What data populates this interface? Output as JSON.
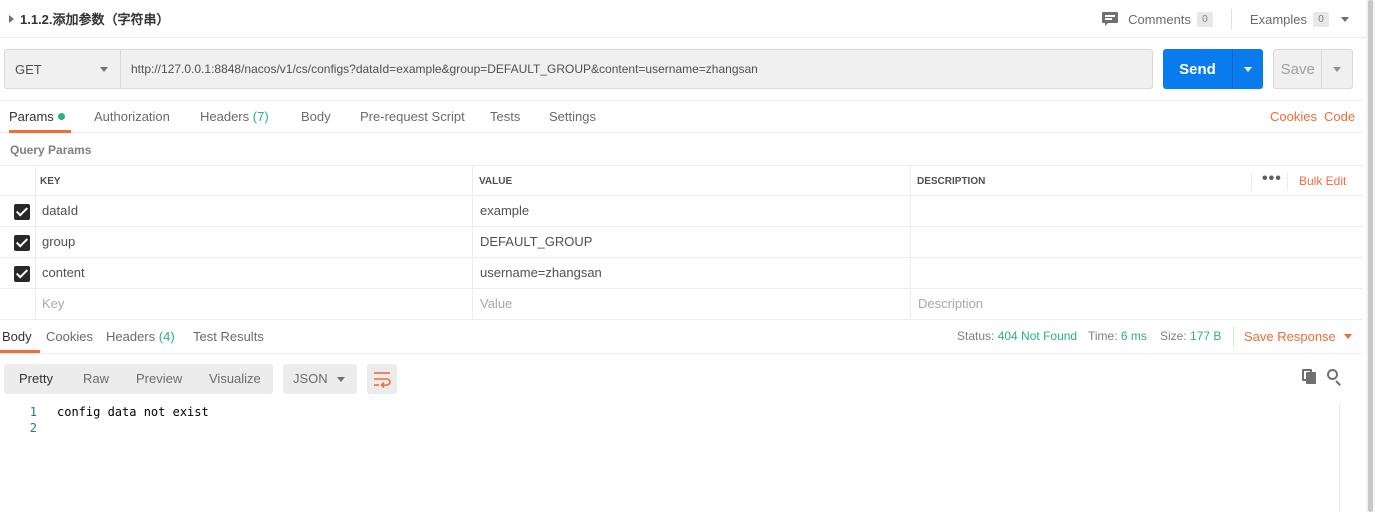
{
  "request": {
    "title": "1.1.2.添加参数（字符串）",
    "comments_label": "Comments",
    "comments_count": "0",
    "examples_label": "Examples",
    "examples_count": "0",
    "method": "GET",
    "url": "http://127.0.0.1:8848/nacos/v1/cs/configs?dataId=example&group=DEFAULT_GROUP&content=username=zhangsan",
    "send_label": "Send",
    "save_label": "Save"
  },
  "request_tabs": {
    "params": "Params",
    "authorization": "Authorization",
    "headers": "Headers",
    "headers_count": "(7)",
    "body": "Body",
    "pre_request_script": "Pre-request Script",
    "tests": "Tests",
    "settings": "Settings",
    "cookies": "Cookies",
    "code": "Code"
  },
  "query_params": {
    "section_label": "Query Params",
    "columns": {
      "key": "KEY",
      "value": "VALUE",
      "description": "DESCRIPTION"
    },
    "more_label": "•••",
    "bulk_edit_label": "Bulk Edit",
    "rows": [
      {
        "key": "dataId",
        "value": "example",
        "description": "",
        "checked": true
      },
      {
        "key": "group",
        "value": "DEFAULT_GROUP",
        "description": "",
        "checked": true
      },
      {
        "key": "content",
        "value": "username=zhangsan",
        "description": "",
        "checked": true
      }
    ],
    "placeholders": {
      "key": "Key",
      "value": "Value",
      "description": "Description"
    }
  },
  "response_tabs": {
    "body": "Body",
    "cookies": "Cookies",
    "headers": "Headers",
    "headers_count": "(4)",
    "test_results": "Test Results"
  },
  "response_meta": {
    "status_label": "Status:",
    "status_value": "404 Not Found",
    "time_label": "Time:",
    "time_value": "6 ms",
    "size_label": "Size:",
    "size_value": "177 B",
    "save_response_label": "Save Response"
  },
  "response_toolbar": {
    "pretty": "Pretty",
    "raw": "Raw",
    "preview": "Preview",
    "visualize": "Visualize",
    "format": "JSON"
  },
  "response_body": {
    "lines": [
      {
        "num": "1",
        "text": "config data not exist"
      },
      {
        "num": "2",
        "text": ""
      }
    ]
  },
  "colors": {
    "accent": "#f26b3a",
    "send_blue": "#097bed",
    "status_green": "#26b47f"
  },
  "icons": {
    "title_caret": "caret-right-icon",
    "comments": "comment-icon",
    "copy": "copy-icon",
    "search": "search-icon",
    "wrap": "wrap-lines-icon"
  }
}
